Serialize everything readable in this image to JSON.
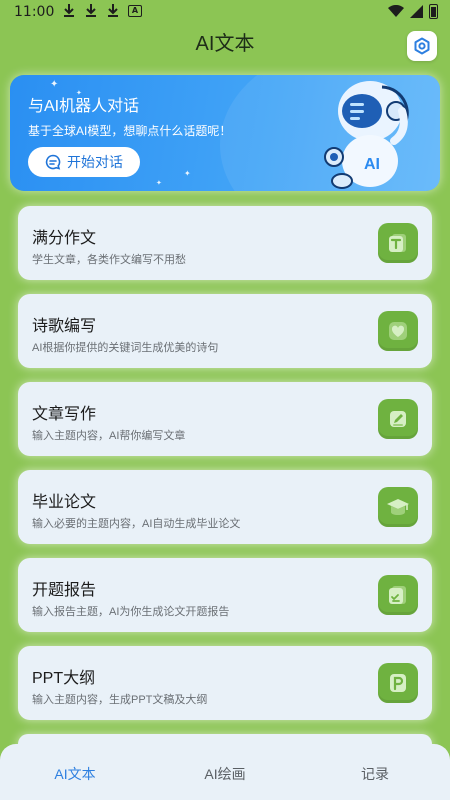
{
  "status_bar": {
    "time": "11:00"
  },
  "app": {
    "title": "AI文本"
  },
  "banner": {
    "title": "与AI机器人对话",
    "subtitle": "基于全球AI模型，想聊点什么话题呢！",
    "button_label": "开始对话",
    "robot_label": "AI"
  },
  "cards": [
    {
      "title": "满分作文",
      "desc": "学生文章，各类作文编写不用愁",
      "icon": "text-doc-icon"
    },
    {
      "title": "诗歌编写",
      "desc": "AI根据你提供的关键词生成优美的诗句",
      "icon": "heart-icon"
    },
    {
      "title": "文章写作",
      "desc": "输入主题内容，AI帮你编写文章",
      "icon": "pen-edit-icon"
    },
    {
      "title": "毕业论文",
      "desc": "输入必要的主题内容，AI自动生成毕业论文",
      "icon": "graduation-cap-icon"
    },
    {
      "title": "开题报告",
      "desc": "输入报告主题，AI为你生成论文开题报告",
      "icon": "report-doc-icon"
    },
    {
      "title": "PPT大纲",
      "desc": "输入主题内容，生成PPT文稿及大纲",
      "icon": "ppt-icon"
    }
  ],
  "bottom_nav": {
    "items": [
      {
        "label": "AI文本",
        "active": true
      },
      {
        "label": "AI绘画",
        "active": false
      },
      {
        "label": "记录",
        "active": false
      }
    ]
  },
  "colors": {
    "background": "#8cc554",
    "banner": "#2a8ff2",
    "card": "#e9f1f8",
    "icon": "#6fb240",
    "nav_active": "#2d7fe0"
  }
}
